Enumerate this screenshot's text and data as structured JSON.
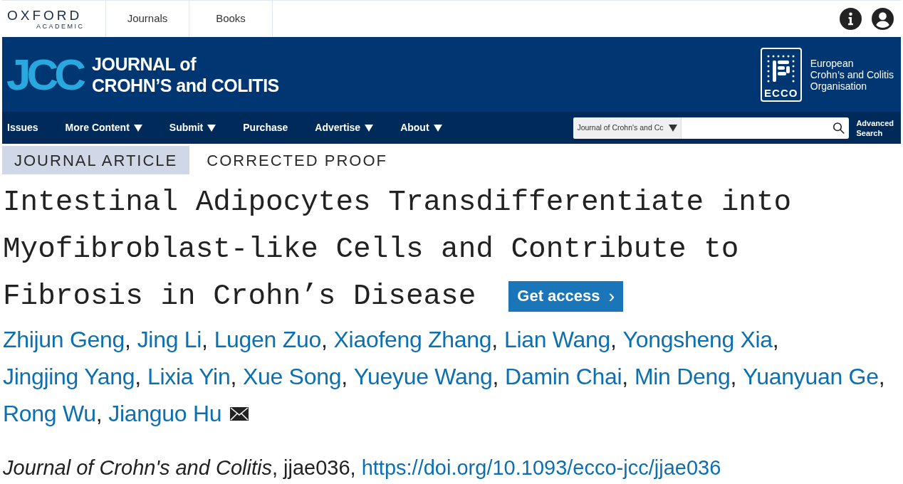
{
  "top_bar": {
    "brand": {
      "name": "OXFORD",
      "sub": "ACADEMIC"
    },
    "links": [
      "Journals",
      "Books"
    ]
  },
  "journal_header": {
    "logo": "JCC",
    "title_line1": "JOURNAL of",
    "title_line2": "CROHN’S and COLITIS",
    "partner": {
      "mark": "ECCO",
      "lines": [
        "European",
        "Crohn’s and Colitis",
        "Organisation"
      ]
    }
  },
  "nav": {
    "items": [
      {
        "label": "Issues",
        "dropdown": false
      },
      {
        "label": "More Content",
        "dropdown": true
      },
      {
        "label": "Submit",
        "dropdown": true
      },
      {
        "label": "Purchase",
        "dropdown": false
      },
      {
        "label": "Advertise",
        "dropdown": true
      },
      {
        "label": "About",
        "dropdown": true
      }
    ],
    "search_scope": "Journal of Crohn's and Cc",
    "advanced_search": [
      "Advanced",
      "Search"
    ]
  },
  "tags": [
    {
      "label": "JOURNAL ARTICLE",
      "highlighted": true
    },
    {
      "label": "CORRECTED PROOF",
      "highlighted": false
    }
  ],
  "article": {
    "title_lines": [
      "Intestinal Adipocytes Transdifferentiate into",
      "Myofibroblast-like Cells and Contribute to",
      "Fibrosis in Crohn’s Disease"
    ],
    "access_button": "Get access",
    "access_caret": "›",
    "author_lines": [
      [
        {
          "name": "Zhijun Geng",
          "sep": ",",
          "corresponding": false
        },
        {
          "name": "Jing Li",
          "sep": ",",
          "corresponding": false
        },
        {
          "name": "Lugen Zuo",
          "sep": ",",
          "corresponding": false
        },
        {
          "name": "Xiaofeng Zhang",
          "sep": ",",
          "corresponding": false
        },
        {
          "name": "Lian Wang",
          "sep": ",",
          "corresponding": false
        },
        {
          "name": "Yongsheng Xia",
          "sep": ",",
          "corresponding": false
        }
      ],
      [
        {
          "name": "Jingjing Yang",
          "sep": ",",
          "corresponding": false
        },
        {
          "name": "Lixia Yin",
          "sep": ",",
          "corresponding": false
        },
        {
          "name": "Xue Song",
          "sep": ",",
          "corresponding": false
        },
        {
          "name": "Yueyue Wang",
          "sep": ",",
          "corresponding": false
        },
        {
          "name": "Damin Chai",
          "sep": ",",
          "corresponding": false
        },
        {
          "name": "Min Deng",
          "sep": ",",
          "corresponding": false
        },
        {
          "name": "Yuanyuan Ge",
          "sep": ",",
          "corresponding": false
        }
      ],
      [
        {
          "name": "Rong Wu",
          "sep": ",",
          "corresponding": false
        },
        {
          "name": "Jianguo Hu",
          "corresponding": true
        }
      ]
    ],
    "citation": "*Journal of Crohn's and Colitis*, jjae036, ",
    "doi": "https://doi.org/10.1093/ecco-jcc/jjae036"
  }
}
